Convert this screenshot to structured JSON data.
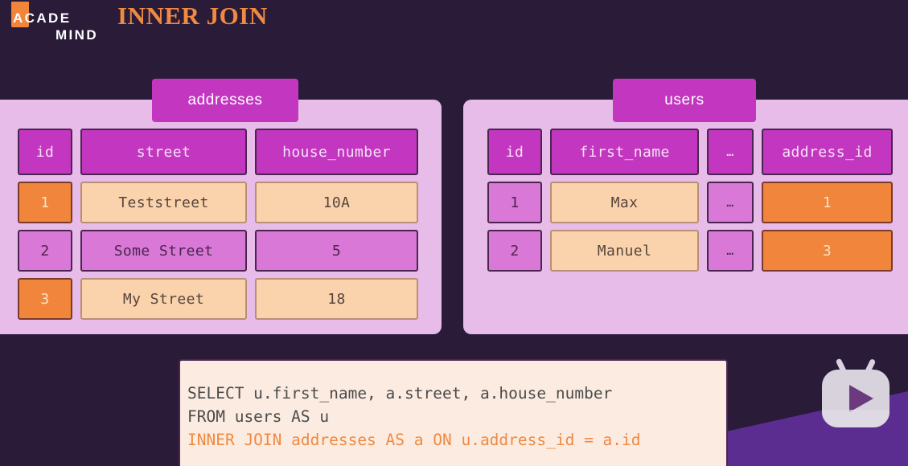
{
  "brand": {
    "line1": "ACADE",
    "line2": "MIND",
    "mark_icon": "bookmark-icon",
    "accent_color": "#f0853b"
  },
  "page_title": "INNER JOIN",
  "background_color": "#2a1b38",
  "tables": [
    {
      "name": "addresses",
      "columns": [
        "id",
        "street",
        "house_number"
      ],
      "rows": [
        {
          "cells": [
            "1",
            "Teststreet",
            "10A"
          ],
          "styles": [
            "orange",
            "peach",
            "peach"
          ]
        },
        {
          "cells": [
            "2",
            "Some Street",
            "5"
          ],
          "styles": [
            "plain",
            "plain",
            "plain"
          ]
        },
        {
          "cells": [
            "3",
            "My Street",
            "18"
          ],
          "styles": [
            "orange",
            "peach",
            "peach"
          ]
        }
      ]
    },
    {
      "name": "users",
      "columns": [
        "id",
        "first_name",
        "…",
        "address_id"
      ],
      "rows": [
        {
          "cells": [
            "1",
            "Max",
            "…",
            "1"
          ],
          "styles": [
            "plain",
            "peach",
            "plain",
            "orange"
          ]
        },
        {
          "cells": [
            "2",
            "Manuel",
            "…",
            "3"
          ],
          "styles": [
            "plain",
            "peach",
            "plain",
            "orange"
          ]
        }
      ]
    }
  ],
  "sql": {
    "line1": "SELECT u.first_name, a.street, a.house_number",
    "line2": "FROM users AS u",
    "line3": "INNER JOIN addresses AS a ON u.address_id = a.id",
    "highlight_color": "#ef8a42"
  },
  "badge": {
    "icon": "tv-play-icon",
    "color": "#d8d2dd"
  },
  "palette": {
    "header_cell": "#c337c0",
    "plain_cell": "#d978d6",
    "peach_cell": "#fad3ad",
    "orange_cell": "#f0853b",
    "panel_bg": "#e7bce8",
    "sql_bg": "#fcebe0",
    "corner_band": "#5b2d91"
  }
}
